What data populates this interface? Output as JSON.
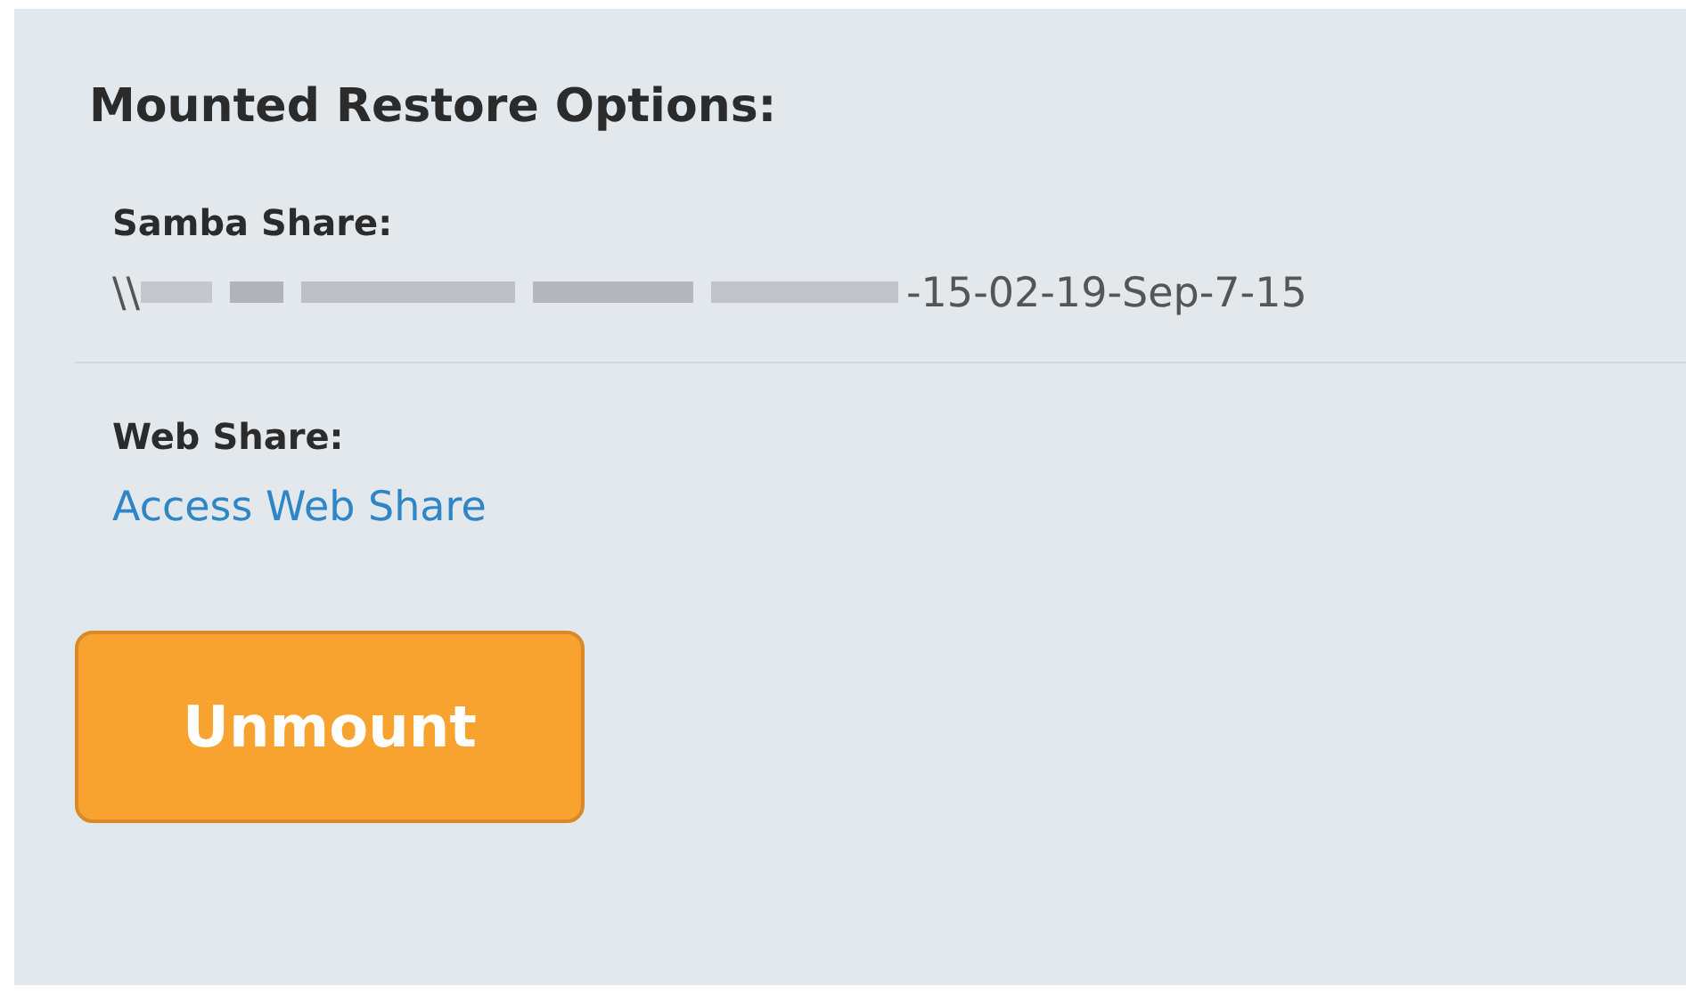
{
  "title": "Mounted Restore Options:",
  "shares": [
    {
      "kind": "path",
      "label": "Samba Share:",
      "path_start": "\\\\",
      "path_end": "-15-02-19-Sep-7-15"
    },
    {
      "kind": "link",
      "label": "Web Share:",
      "link": "Access Web Share"
    }
  ],
  "button": "Unmount"
}
